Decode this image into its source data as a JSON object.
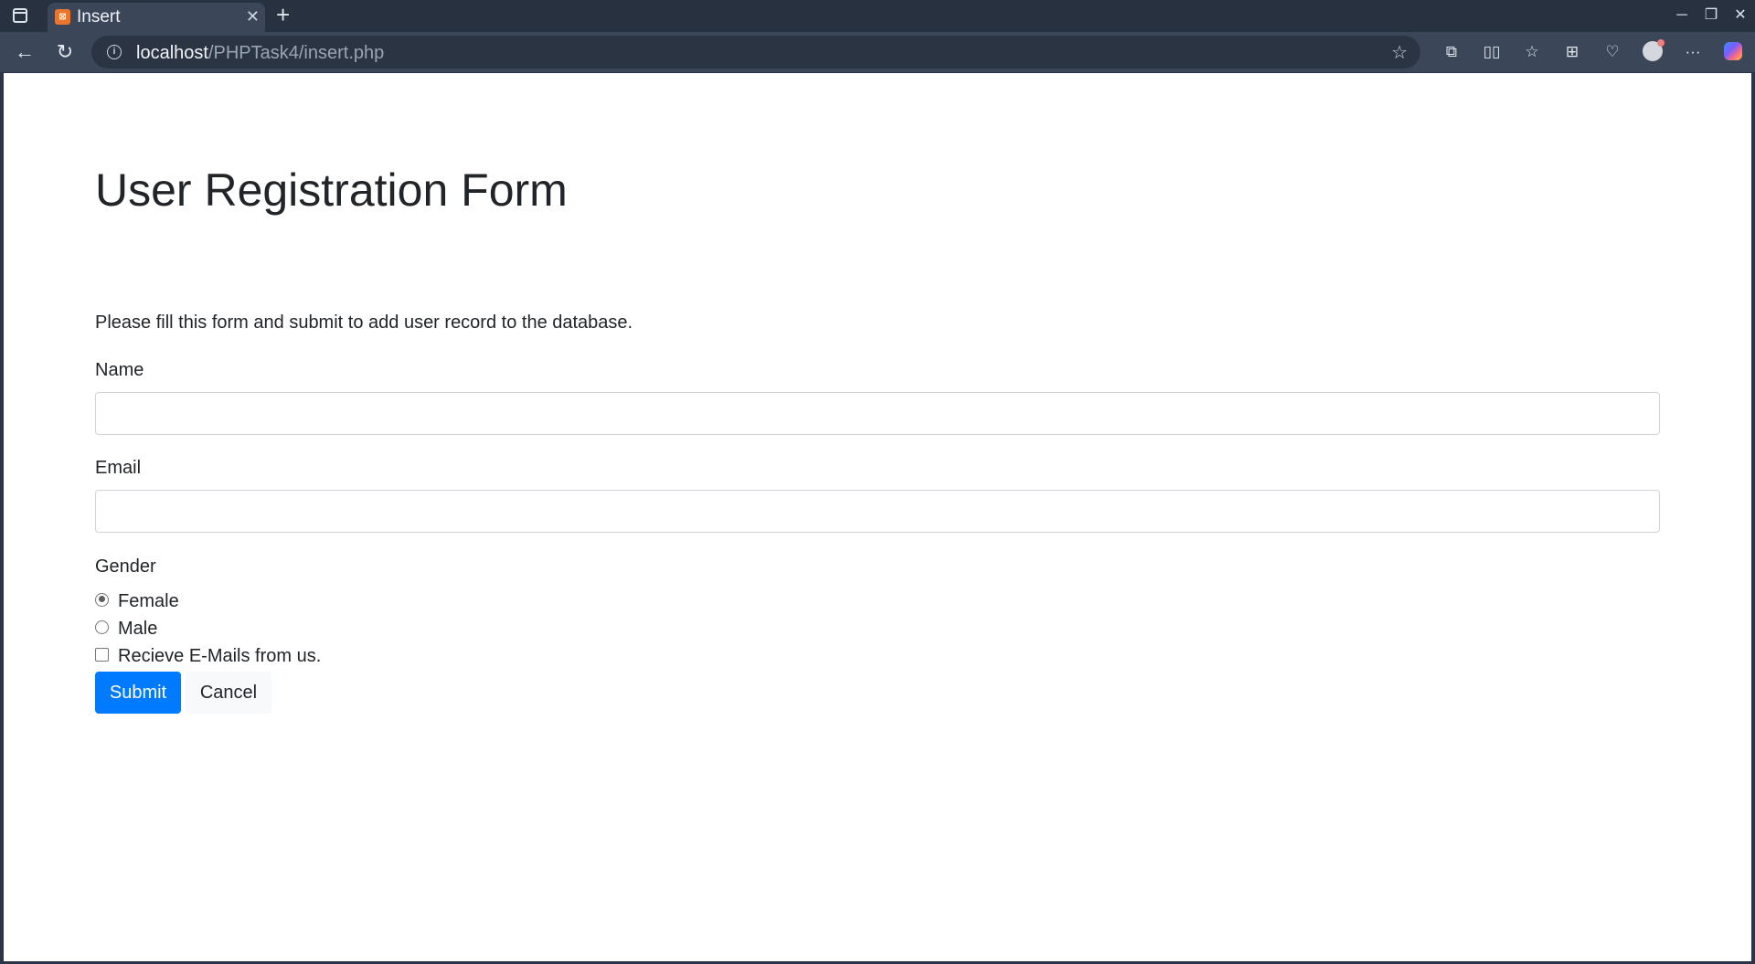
{
  "browser": {
    "tab_title": "Insert",
    "tab_favicon": "xampp-icon",
    "url_host": "localhost",
    "url_path": "/PHPTask4/insert.php",
    "window_controls": [
      "minimize",
      "restore",
      "close"
    ],
    "toolbar_icons": [
      "extensions-icon",
      "split-screen-icon",
      "favorites-icon",
      "collections-icon",
      "browser-essentials-icon",
      "profile-avatar",
      "more-icon",
      "copilot-icon"
    ]
  },
  "form": {
    "title": "User Registration Form",
    "intro": "Please fill this form and submit to add user record to the database.",
    "name_label": "Name",
    "name_value": "",
    "email_label": "Email",
    "email_value": "",
    "gender_label": "Gender",
    "gender_options": [
      {
        "label": "Female",
        "checked": true
      },
      {
        "label": "Male",
        "checked": false
      }
    ],
    "newsletter_label": "Recieve E-Mails from us.",
    "newsletter_checked": false,
    "submit_label": "Submit",
    "cancel_label": "Cancel"
  },
  "colors": {
    "primary": "#007bff",
    "text": "#212529",
    "chrome_dark": "#27313f",
    "chrome_toolbar": "#3b4759"
  }
}
